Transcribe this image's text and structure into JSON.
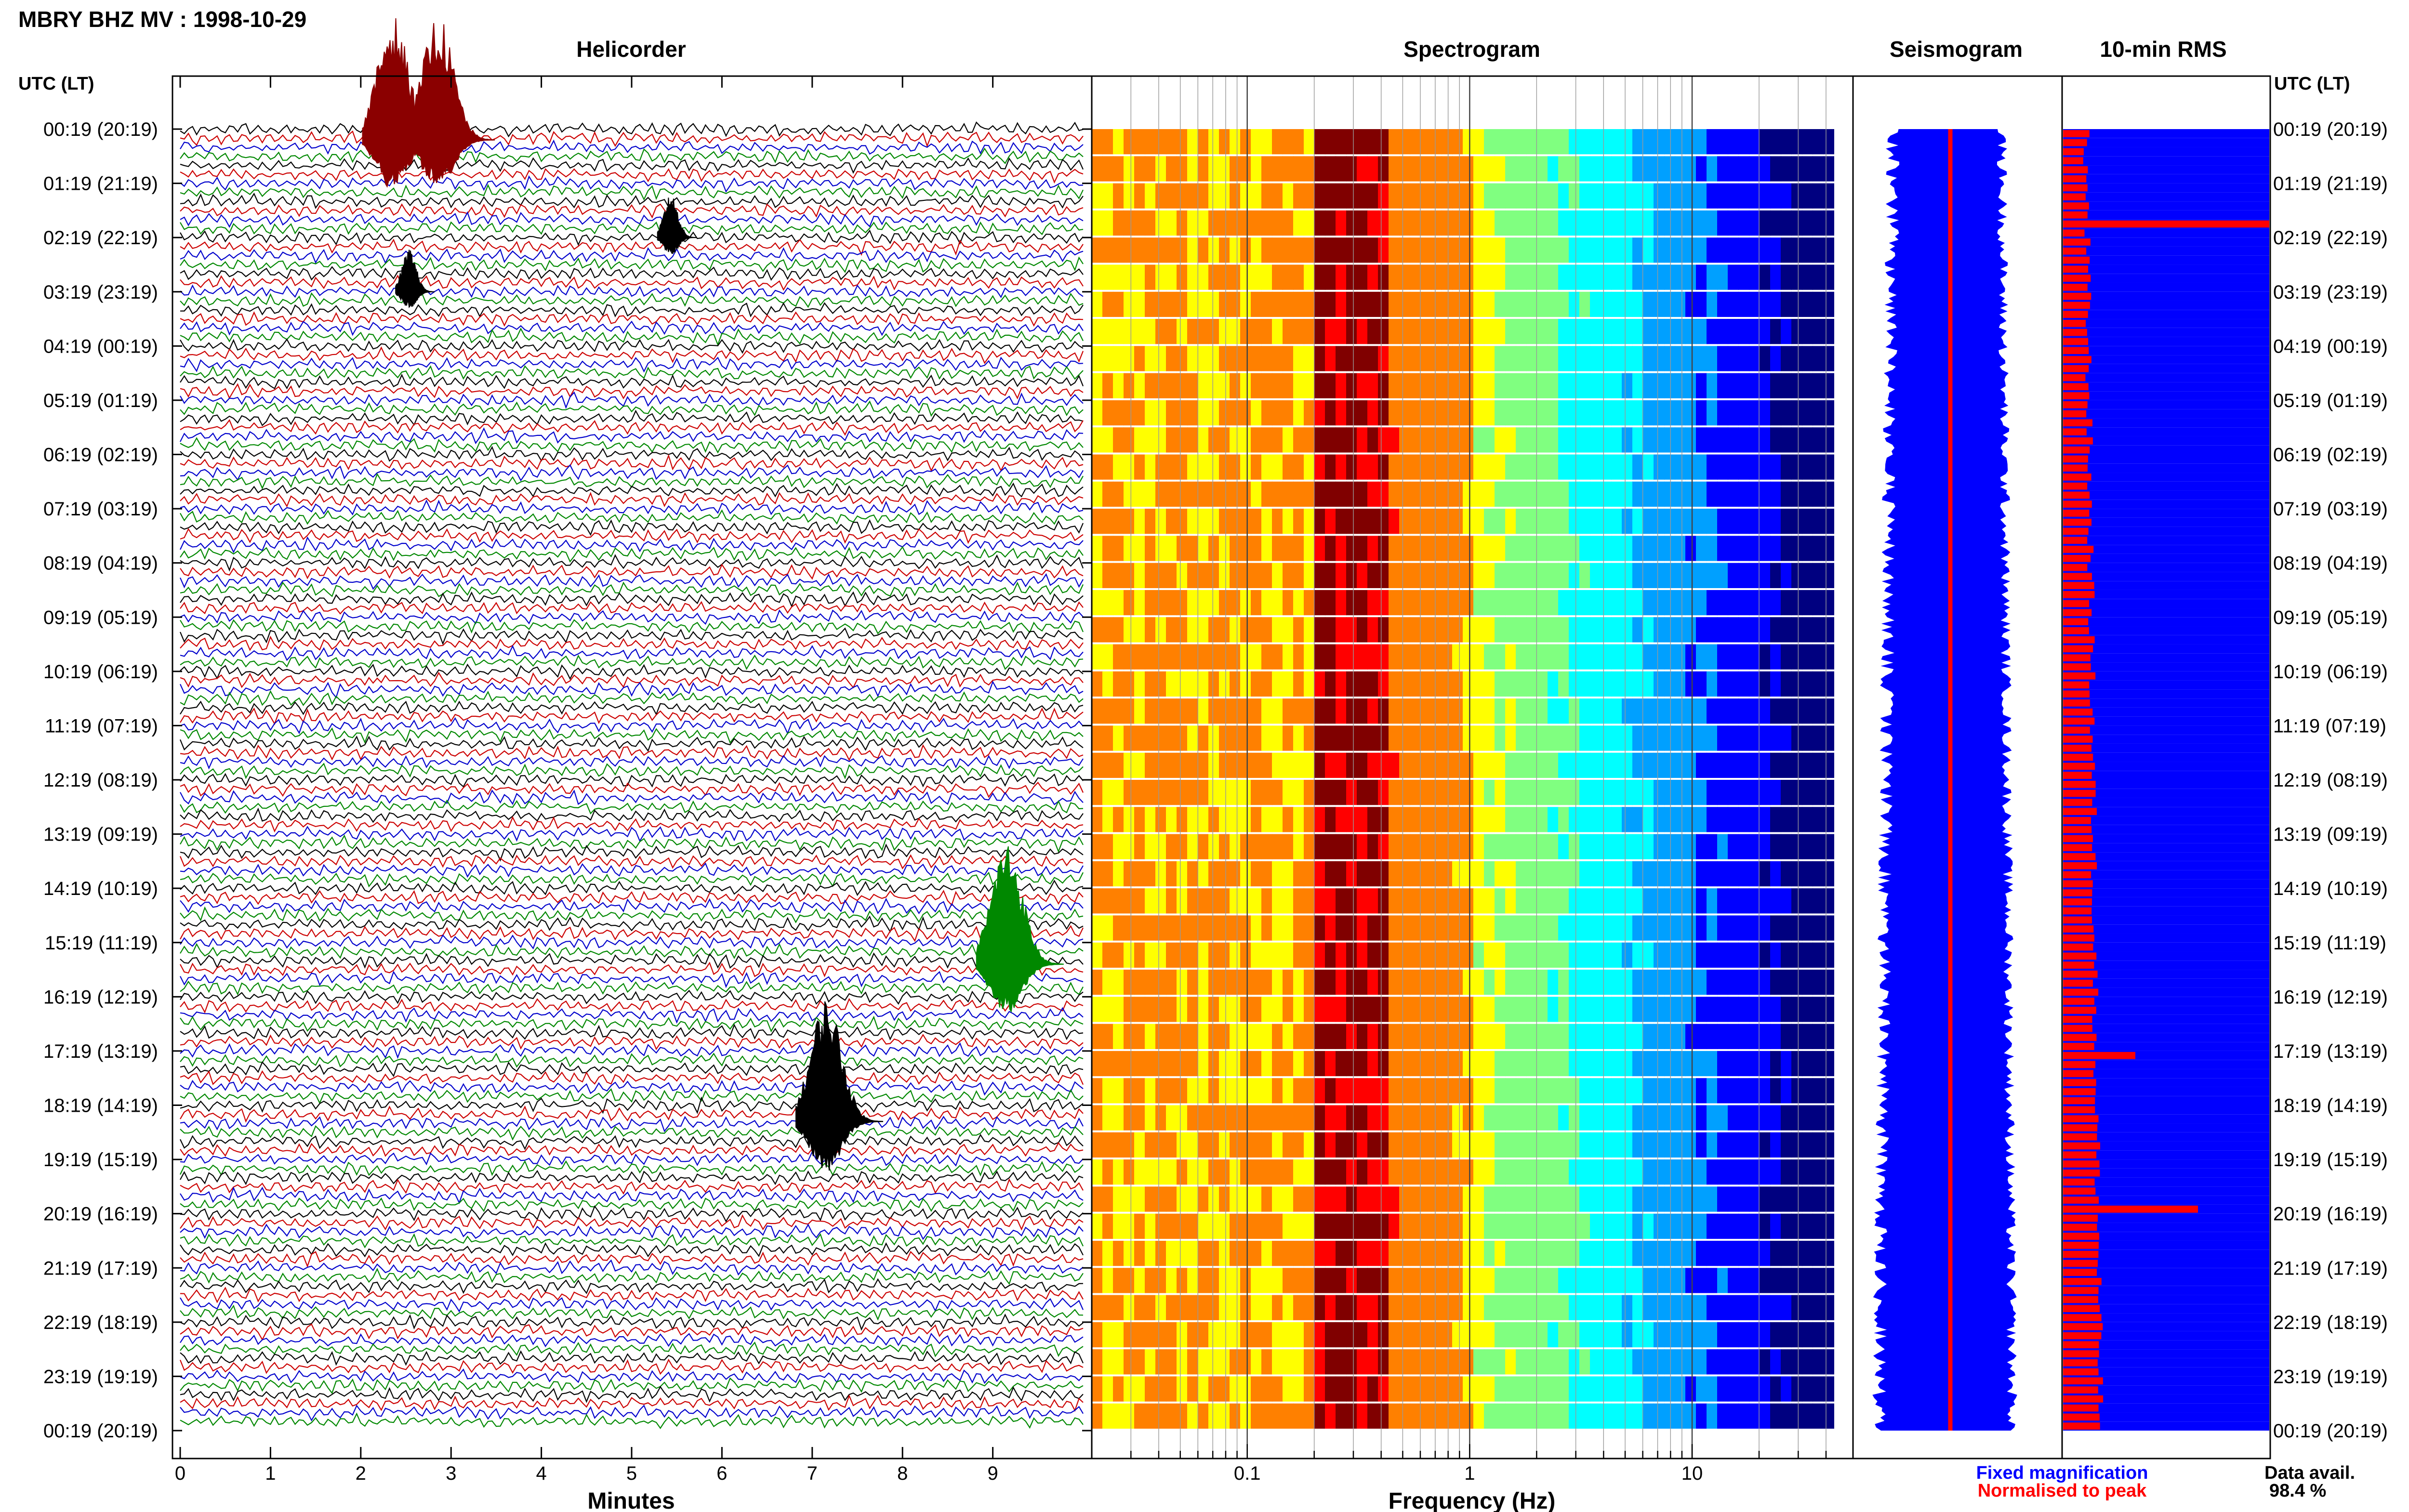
{
  "header": {
    "title": "MBRY BHZ MV : 1998-10-29"
  },
  "panels": {
    "helicorder": "Helicorder",
    "spectrogram": "Spectrogram",
    "seismogram": "Seismogram",
    "rms": "10-min RMS"
  },
  "time_axis": {
    "label_left": "UTC (LT)",
    "label_right": "UTC (LT)",
    "labels": [
      "00:19 (20:19)",
      "01:19 (21:19)",
      "02:19 (22:19)",
      "03:19 (23:19)",
      "04:19 (00:19)",
      "05:19 (01:19)",
      "06:19 (02:19)",
      "07:19 (03:19)",
      "08:19 (04:19)",
      "09:19 (05:19)",
      "10:19 (06:19)",
      "11:19 (07:19)",
      "12:19 (08:19)",
      "13:19 (09:19)",
      "14:19 (10:19)",
      "15:19 (11:19)",
      "16:19 (12:19)",
      "17:19 (13:19)",
      "18:19 (14:19)",
      "19:19 (15:19)",
      "20:19 (16:19)",
      "21:19 (17:19)",
      "22:19 (18:19)",
      "23:19 (19:19)",
      "00:19 (20:19)"
    ]
  },
  "helicorder_axis": {
    "label": "Minutes",
    "ticks": [
      "0",
      "1",
      "2",
      "3",
      "4",
      "5",
      "6",
      "7",
      "8",
      "9"
    ]
  },
  "spectrogram_axis": {
    "label": "Frequency (Hz)",
    "ticks": [
      "0.1",
      "1",
      "10"
    ]
  },
  "legend": {
    "fixed": "Fixed magnification",
    "normalised": "Normalised to peak",
    "fixed_color": "#0000ff",
    "normalised_color": "#ff0000",
    "avail_label": "Data avail.",
    "avail_value": "98.4 %"
  },
  "chart_data": {
    "type": "seismic-multipanel",
    "station": "MBRY",
    "channel": "BHZ",
    "network": "MV",
    "date": "1998-10-29",
    "helicorder": {
      "row_minutes": 10,
      "rows": 144,
      "trace_colors": [
        "#000000",
        "#cc0000",
        "#0000cc",
        "#008800"
      ],
      "xlim": [
        0,
        10
      ],
      "events": [
        {
          "hour": 0.2,
          "minute": 2.5,
          "amplitude": "large",
          "color": "#8b0000"
        },
        {
          "hour": 0.2,
          "minute": 3.0,
          "amplitude": "large",
          "color": "#8b0000"
        },
        {
          "hour": 2.0,
          "minute": 5.5,
          "amplitude": "medium",
          "color": "#000000"
        },
        {
          "hour": 3.0,
          "minute": 2.6,
          "amplitude": "medium",
          "color": "#000000"
        },
        {
          "hour": 15.4,
          "minute": 9.3,
          "amplitude": "large",
          "color": "#008800"
        },
        {
          "hour": 18.3,
          "minute": 7.3,
          "amplitude": "large",
          "color": "#000000"
        }
      ]
    },
    "spectrogram": {
      "xscale": "log",
      "xlim_hz": [
        0.02,
        40
      ],
      "peak_band_hz": [
        0.2,
        0.45
      ],
      "colormap": [
        "#000080",
        "#0000ff",
        "#00a0ff",
        "#00ffff",
        "#80ff80",
        "#ffff00",
        "#ff8000",
        "#ff0000",
        "#800000"
      ]
    },
    "rms_10min": {
      "rows": 144,
      "fixed_color": "#0000ff",
      "normalised_color": "#ff0000",
      "peaks": [
        {
          "hour": 1.6,
          "value": "high"
        },
        {
          "hour": 17.0,
          "value": "medium"
        },
        {
          "hour": 19.8,
          "value": "high"
        }
      ]
    },
    "data_availability_percent": 98.4
  }
}
